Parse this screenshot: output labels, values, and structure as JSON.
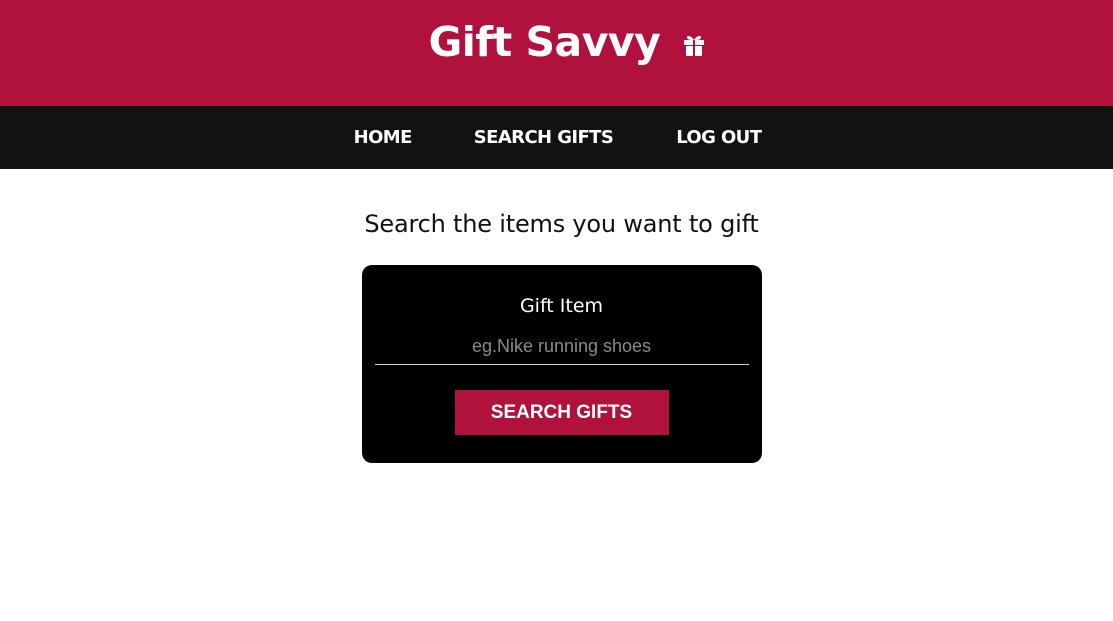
{
  "header": {
    "title": "Gift Savvy",
    "icon": "gift-icon",
    "background": "#b0123d"
  },
  "nav": {
    "background": "#121212",
    "items": [
      {
        "label": "HOME"
      },
      {
        "label": "SEARCH GIFTS"
      },
      {
        "label": "LOG OUT"
      }
    ]
  },
  "main": {
    "heading": "Search the items you want to gift",
    "form": {
      "label": "Gift Item",
      "input_value": "",
      "input_placeholder": "eg.Nike running shoes",
      "submit_label": "SEARCH GIFTS",
      "accent": "#b0123d"
    }
  }
}
